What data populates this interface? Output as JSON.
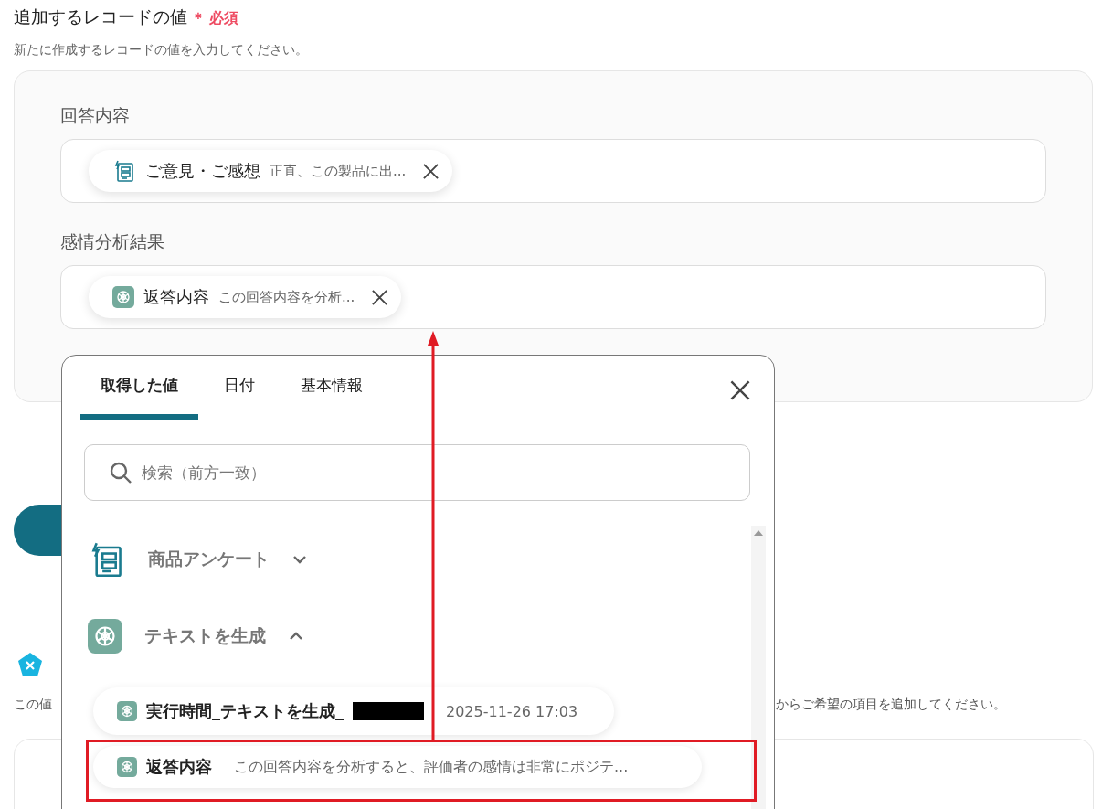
{
  "section": {
    "title": "追加するレコードの値",
    "required_mark": "＊",
    "required_label": "必須",
    "description": "新たに作成するレコードの値を入力してください。"
  },
  "fields": [
    {
      "label": "回答内容",
      "chip": {
        "kind": "form",
        "name": "ご意見・ご感想",
        "value": "正直、この製品に出..."
      }
    },
    {
      "label": "感情分析結果",
      "chip": {
        "kind": "ai",
        "name": "返答内容",
        "value": "この回答内容を分析..."
      }
    }
  ],
  "background": {
    "note_left": "この値",
    "note_right": "からご希望の項目を追加してください。"
  },
  "popup": {
    "tabs": [
      {
        "label": "取得した値",
        "selected": true
      },
      {
        "label": "日付",
        "selected": false
      },
      {
        "label": "基本情報",
        "selected": false
      }
    ],
    "search": {
      "placeholder": "検索（前方一致）"
    },
    "groups": [
      {
        "kind": "form",
        "label": "商品アンケート",
        "expanded": false
      },
      {
        "kind": "ai",
        "label": "テキストを生成",
        "expanded": true,
        "items": [
          {
            "name": "実行時間_テキストを生成_",
            "redacted": true,
            "value": "2025-11-26 17:03",
            "highlighted": false
          },
          {
            "name": "返答内容",
            "redacted": false,
            "value": "この回答内容を分析すると、評価者の感情は非常にポジテ...",
            "highlighted": true
          }
        ]
      }
    ]
  }
}
